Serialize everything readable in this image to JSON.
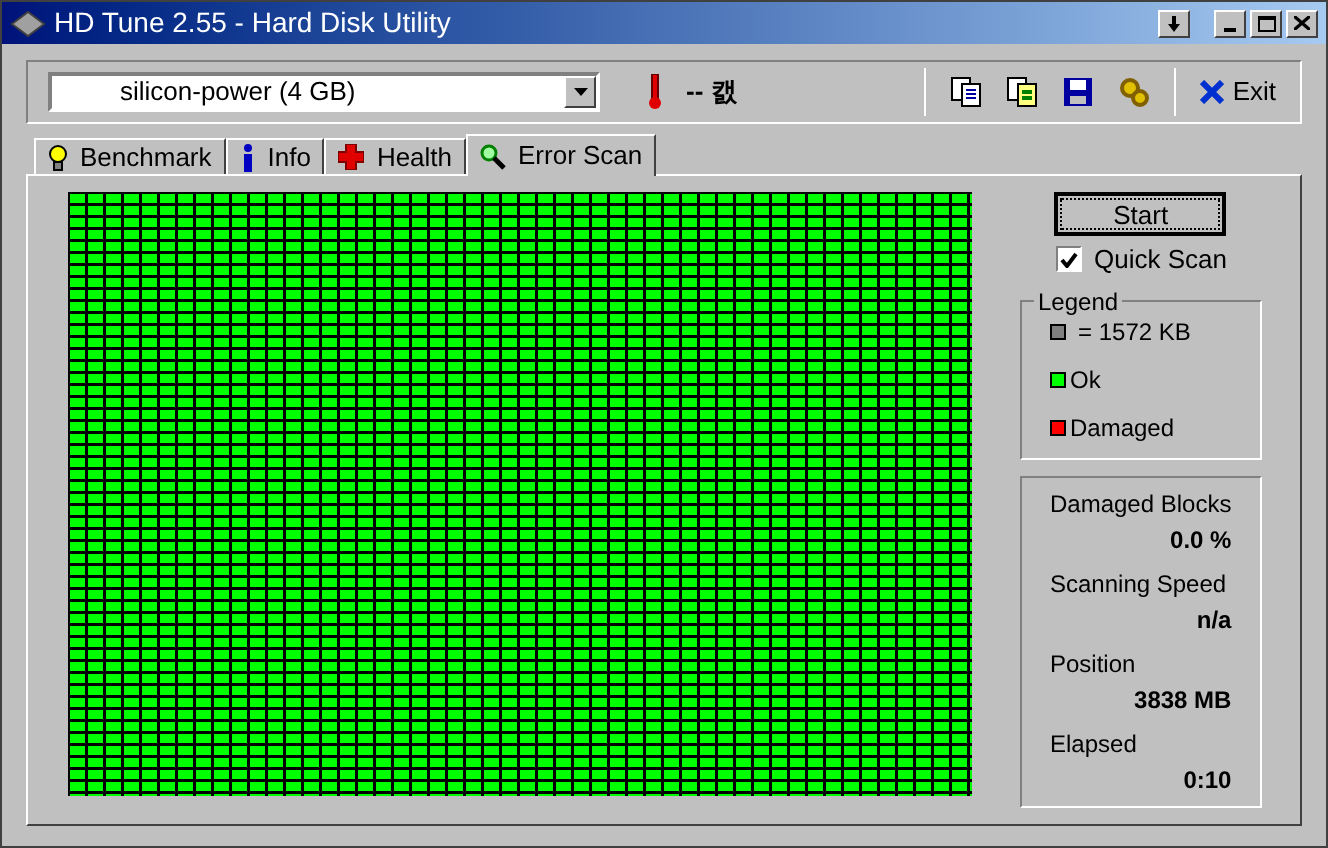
{
  "window": {
    "title": "HD Tune 2.55 - Hard Disk Utility"
  },
  "drive_select": {
    "value": "silicon-power (4 GB)"
  },
  "temperature": "-- 캜",
  "exit_button": "Exit",
  "tabs": [
    {
      "label": "Benchmark",
      "selected": false,
      "kind": "bulb"
    },
    {
      "label": "Info",
      "selected": false,
      "kind": "info"
    },
    {
      "label": "Health",
      "selected": false,
      "kind": "cross"
    },
    {
      "label": "Error Scan",
      "selected": true,
      "kind": "magnifier"
    }
  ],
  "start_button": "Start",
  "quick_scan": {
    "label": "Quick Scan",
    "checked": true
  },
  "legend": {
    "title": "Legend",
    "items": [
      {
        "label": "= 1572 KB",
        "color": "#808080"
      },
      {
        "label": "Ok",
        "color": "#00ff00"
      },
      {
        "label": "Damaged",
        "color": "#ff0000"
      }
    ]
  },
  "stats": [
    {
      "label": "Damaged Blocks",
      "value": "0.0 %"
    },
    {
      "label": "Scanning Speed",
      "value": "n/a"
    },
    {
      "label": "Position",
      "value": "3838 MB"
    },
    {
      "label": "Elapsed",
      "value": "0:10"
    }
  ]
}
